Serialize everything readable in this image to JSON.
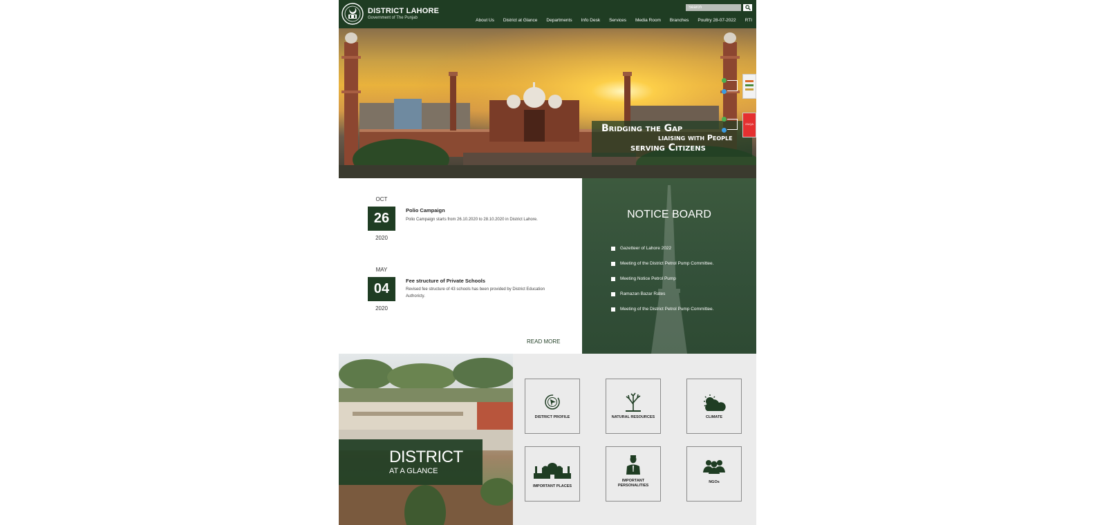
{
  "header": {
    "title": "DISTRICT LAHORE",
    "subtitle": "Government of The Punjab",
    "search_placeholder": "Search",
    "nav": [
      "About Us",
      "District at Glance",
      "Departments",
      "Info Desk",
      "Services",
      "Media Room",
      "Branches",
      "Poultry 28-07-2022",
      "RTI"
    ]
  },
  "hero": {
    "tagline_line1": "Bridging the Gap",
    "tagline_line2": "liaising with People",
    "tagline_line3": "serving Citizens",
    "side_widget_label": "ZAIQA",
    "slides_total": 2,
    "active_slide": 2
  },
  "events": [
    {
      "month": "OCT",
      "day": "26",
      "year": "2020",
      "title": "Polio Campaign",
      "desc": "Polio Campaign starts from 26.10.2020 to 28.10.2020 in District Lahore."
    },
    {
      "month": "MAY",
      "day": "04",
      "year": "2020",
      "title": "Fee structure of Private Schools",
      "desc": "Revised fee structure of 43 schools has been provided by District Education Authoricty."
    }
  ],
  "read_more": "READ MORE",
  "notice_board": {
    "title": "NOTICE BOARD",
    "items": [
      "Gazetteer of Lahore 2022",
      "Meeting of the District Petrol Pump Committee.",
      "Meeting Notice Petrol Pump",
      "Ramazan Bazar Rates",
      "Meeting of the District Petrol Pump Committee."
    ]
  },
  "glance": {
    "line1": "DISTRICT",
    "line2": "AT A GLANCE"
  },
  "tiles": [
    {
      "label": "DISTRICT PROFILE",
      "icon": "compass-icon"
    },
    {
      "label": "NATURAL RESOURCES",
      "icon": "tree-icon"
    },
    {
      "label": "CLIMATE",
      "icon": "cloud-sun-icon"
    },
    {
      "label": "IMPORTANT PLACES",
      "icon": "mosque-icon"
    },
    {
      "label": "IMPORTANT PERSONALITIES",
      "icon": "person-icon"
    },
    {
      "label": "NGOs",
      "icon": "group-icon"
    }
  ],
  "colors": {
    "brand_green": "#1f3d23",
    "notice_green": "#34513a",
    "tile_bg": "#ebebeb"
  }
}
